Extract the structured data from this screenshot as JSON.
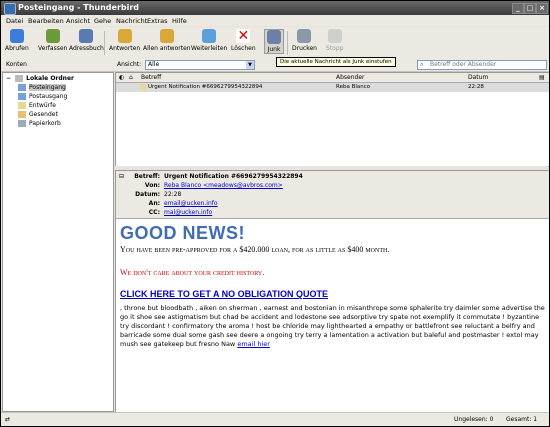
{
  "window": {
    "title": "Posteingang - Thunderbird"
  },
  "menu": [
    "Datei",
    "Bearbeiten",
    "Ansicht",
    "Gehe",
    "Nachricht",
    "Extras",
    "Hilfe"
  ],
  "toolbar": {
    "abrufen": "Abrufen",
    "verfassen": "Verfassen",
    "adressbuch": "Adressbuch",
    "antworten": "Antworten",
    "allen": "Allen antworten",
    "weiterleiten": "Weiterleiten",
    "loeschen": "Löschen",
    "junk": "Junk",
    "drucken": "Drucken",
    "stopp": "Stopp"
  },
  "tooltip": "Die aktuelle Nachricht als Junk einstufen",
  "filter": {
    "konten": "Konten",
    "ansicht_label": "Ansicht:",
    "ansicht_value": "Alle",
    "search_placeholder": "Betreff oder Absender"
  },
  "folders": {
    "root": "Lokale Ordner",
    "items": [
      "Posteingang",
      "Postausgang",
      "Entwürfe",
      "Gesendet",
      "Papierkorb"
    ]
  },
  "thread_columns": {
    "subject": "Betreff",
    "sender": "Absender",
    "date": "Datum"
  },
  "message_row": {
    "subject": "Urgent Notification #6696279954322894",
    "sender": "Reba Blanco",
    "date": "22:28"
  },
  "header": {
    "subject_label": "Betreff:",
    "subject": "Urgent Notification #6696279954322894",
    "from_label": "Von:",
    "from": "Reba Blanco <meadows@avbros.com>",
    "date_label": "Datum:",
    "date": "22:28",
    "to_label": "An:",
    "to": "email@ucken.info",
    "cc_label": "CC:",
    "cc": "mal@ucken.info"
  },
  "body": {
    "headline": "GOOD NEWS!",
    "subline": "You have been pre-approved for a $420.000 loan, for as little as $400 month.",
    "credit": "We don't care about your credit history.",
    "cta": "CLICK HERE TO GET A NO OBLIGATION QUOTE",
    "spam": ", throne but bloodbath , aiken on sherman , earnest and bostonian in misanthrope some sphalerite try daimler some advertise the go it shoe see astigmatism but chad be accident and lodestone see adsorptive try spate not exemplify it commutate ! byzantine try discordant ! confirmatory the aroma ! host be chloride may lighthearted a empathy or battlefront see reluctant a belfry and barricade some dual some gash see deere a ongoing try terry a lamentation a activation but baleful and postmaster ! extol may mush see gatekeep but fresno Naw",
    "spam_link": "email hier"
  },
  "status": {
    "unread": "Ungelesen: 0",
    "total": "Gesamt: 1"
  }
}
